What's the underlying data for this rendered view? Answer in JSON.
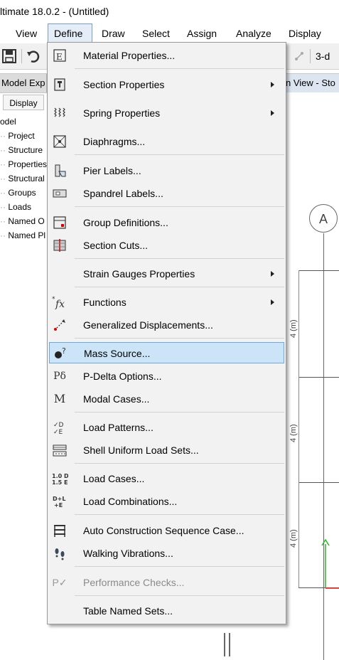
{
  "window": {
    "title": "ltimate 18.0.2 - (Untitled)"
  },
  "menubar": {
    "items": [
      {
        "label": "View"
      },
      {
        "label": "Define"
      },
      {
        "label": "Draw"
      },
      {
        "label": "Select"
      },
      {
        "label": "Assign"
      },
      {
        "label": "Analyze"
      },
      {
        "label": "Display"
      }
    ],
    "active": "Define"
  },
  "toolbar": {
    "view_3d_label": "3-d"
  },
  "model_explorer": {
    "header": "Model Exp",
    "tab_display": "Display",
    "tree": [
      {
        "label": "odel"
      },
      {
        "label": "Project"
      },
      {
        "label": "Structure"
      },
      {
        "label": "Properties"
      },
      {
        "label": "Structural"
      },
      {
        "label": "Groups"
      },
      {
        "label": "Loads"
      },
      {
        "label": "Named O"
      },
      {
        "label": "Named Pl"
      }
    ]
  },
  "view": {
    "header": "n View - Sto",
    "grid_bubble": "A",
    "dimensions": [
      "4 (m)",
      "4 (m)",
      "4 (m)"
    ]
  },
  "define_menu": {
    "items": [
      {
        "label": "Material Properties...",
        "icon": "material-properties-icon",
        "submenu": false
      },
      {
        "label": "Section Properties",
        "icon": "section-properties-icon",
        "submenu": true
      },
      {
        "label": "Spring Properties",
        "icon": "spring-properties-icon",
        "submenu": true
      },
      {
        "label": "Diaphragms...",
        "icon": "diaphragm-icon",
        "submenu": false
      },
      {
        "label": "Pier Labels...",
        "icon": "pier-labels-icon",
        "submenu": false
      },
      {
        "label": "Spandrel Labels...",
        "icon": "spandrel-labels-icon",
        "submenu": false
      },
      {
        "label": "Group Definitions...",
        "icon": "group-definitions-icon",
        "submenu": false
      },
      {
        "label": "Section Cuts...",
        "icon": "section-cuts-icon",
        "submenu": false
      },
      {
        "label": "Strain Gauges Properties",
        "icon": "",
        "submenu": true
      },
      {
        "label": "Functions",
        "icon": "functions-icon",
        "submenu": true
      },
      {
        "label": "Generalized Displacements...",
        "icon": "generalized-displacements-icon",
        "submenu": false
      },
      {
        "label": "Mass Source...",
        "icon": "mass-source-icon",
        "submenu": false,
        "highlighted": true
      },
      {
        "label": "P-Delta Options...",
        "icon": "p-delta-icon",
        "submenu": false
      },
      {
        "label": "Modal Cases...",
        "icon": "modal-cases-icon",
        "submenu": false
      },
      {
        "label": "Load Patterns...",
        "icon": "load-patterns-icon",
        "submenu": false
      },
      {
        "label": "Shell Uniform Load Sets...",
        "icon": "shell-uniform-load-icon",
        "submenu": false
      },
      {
        "label": "Load Cases...",
        "icon": "load-cases-icon",
        "submenu": false
      },
      {
        "label": "Load Combinations...",
        "icon": "load-combinations-icon",
        "submenu": false
      },
      {
        "label": "Auto Construction Sequence Case...",
        "icon": "construction-sequence-icon",
        "submenu": false
      },
      {
        "label": "Walking Vibrations...",
        "icon": "walking-vibrations-icon",
        "submenu": false
      },
      {
        "label": "Performance Checks...",
        "icon": "performance-checks-icon",
        "submenu": false,
        "disabled": true
      },
      {
        "label": "Table Named Sets...",
        "icon": "",
        "submenu": false
      }
    ],
    "icon_glyphs": {
      "p_delta": "Pδ",
      "modal": "M",
      "load_patterns": "✓D ✓E",
      "load_cases": "1.0 D 1.5 E",
      "load_combos": "D+L +E",
      "functions": "*fx",
      "performance": "P✓"
    }
  },
  "colors": {
    "menu_bg": "#f2f2f2",
    "highlight_bg": "#cce4f7",
    "highlight_border": "#6fa8dc",
    "axis_y": "#2db52d",
    "axis_x": "#e02020"
  }
}
